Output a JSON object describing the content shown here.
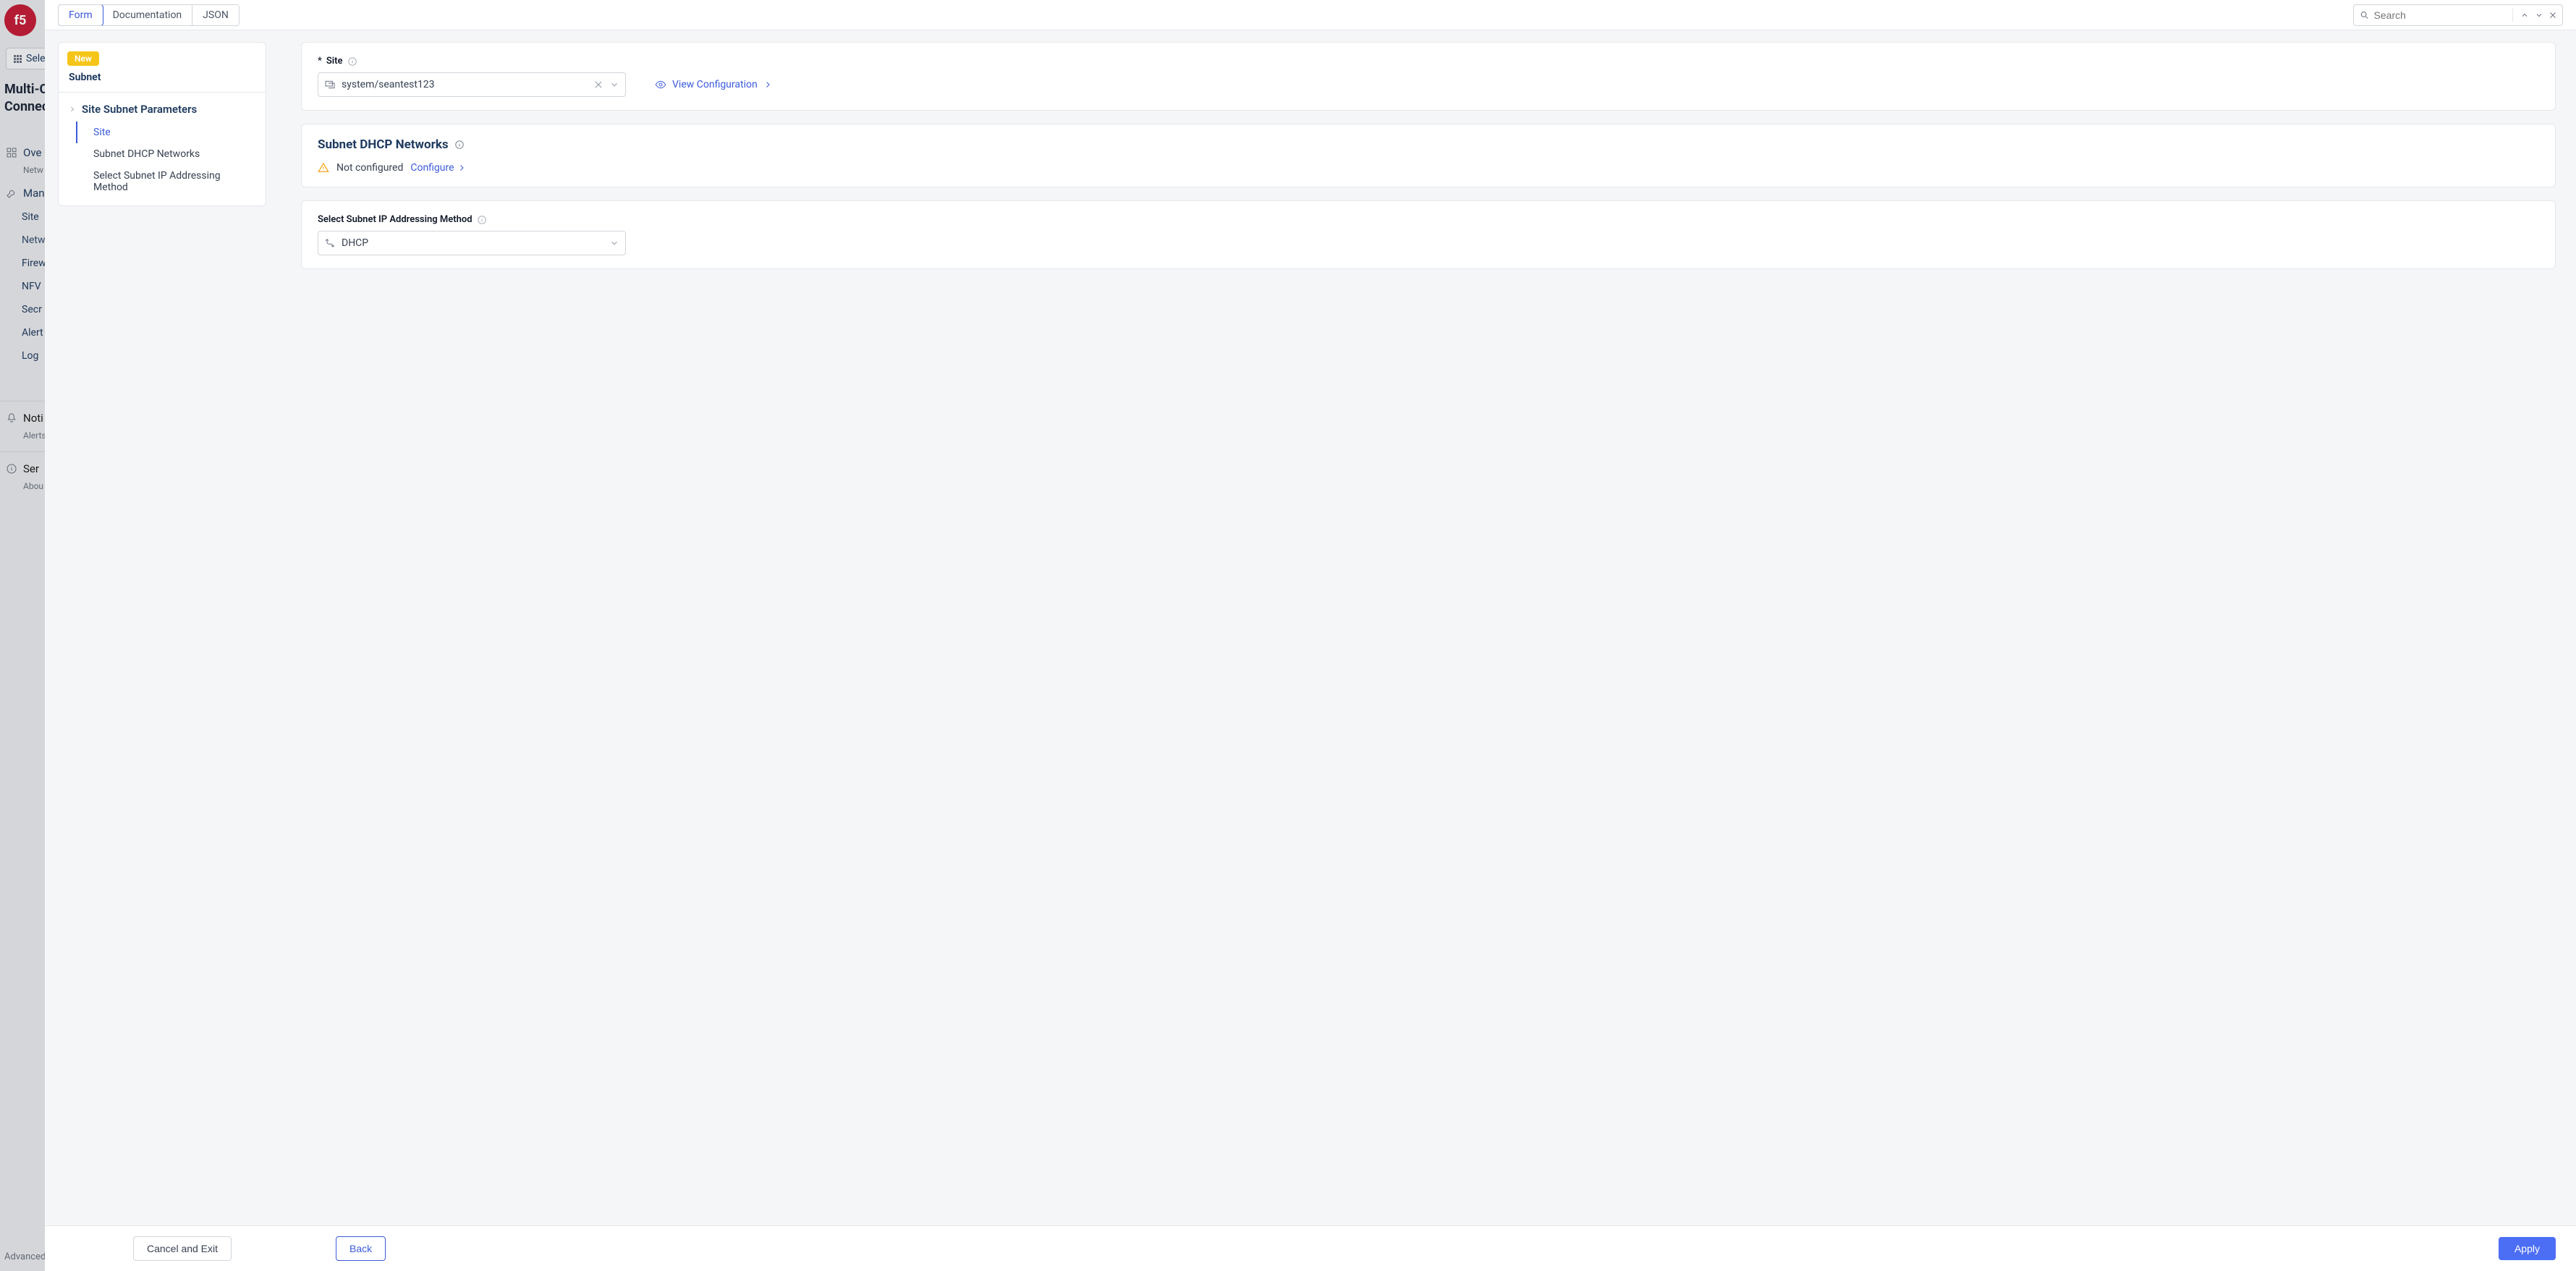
{
  "underlay": {
    "logo_text": "f5",
    "select_btn": "Sele",
    "heading": "Multi-C\nConnec",
    "nav": {
      "overview": "Ove",
      "overview_sub": "Netw",
      "manage": "Man",
      "items": [
        "Site",
        "Netw",
        "Firew",
        "NFV",
        "Secr",
        "Alert",
        "Log"
      ],
      "notifications": "Noti",
      "notifications_sub": "Alerts",
      "service": "Ser",
      "service_sub": "Abou",
      "advanced": "Advanced"
    }
  },
  "tabs": {
    "form": "Form",
    "documentation": "Documentation",
    "json": "JSON"
  },
  "search": {
    "placeholder": "Search"
  },
  "left_nav": {
    "badge": "New",
    "crumb": "Subnet",
    "group": "Site Subnet Parameters",
    "items": [
      "Site",
      "Subnet DHCP Networks",
      "Select Subnet IP Addressing Method"
    ]
  },
  "form": {
    "site": {
      "label": "Site",
      "required_mark": "*",
      "value": "system/seantest123",
      "view_link": "View Configuration"
    },
    "dhcp_section": {
      "title": "Subnet DHCP Networks",
      "not_configured": "Not configured",
      "configure": "Configure"
    },
    "addressing": {
      "label": "Select Subnet IP Addressing Method",
      "value": "DHCP"
    }
  },
  "footer": {
    "cancel": "Cancel and Exit",
    "back": "Back",
    "apply": "Apply"
  }
}
